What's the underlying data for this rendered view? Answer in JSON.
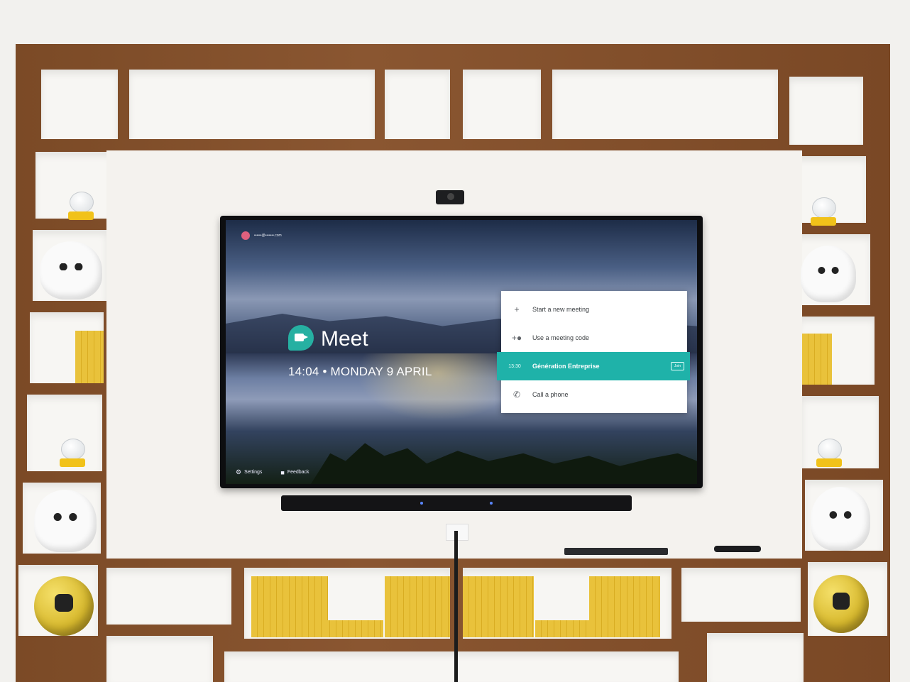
{
  "account": {
    "email": "••••••@•••••••.com"
  },
  "app": {
    "name": "Meet"
  },
  "clock": {
    "text": "14:04 • MONDAY 9 APRIL"
  },
  "menu": {
    "items": [
      {
        "icon": "plus-icon",
        "label": "Start a new meeting"
      },
      {
        "icon": "add-person-icon",
        "label": "Use a meeting code"
      },
      {
        "icon": "phone-icon",
        "label": "Call a phone"
      }
    ],
    "scheduled": {
      "time": "13:30",
      "title": "Génération Entreprise",
      "action": "Join"
    }
  },
  "footer": {
    "settings": "Settings",
    "feedback": "Feedback"
  },
  "colors": {
    "accent": "#1fb2a9",
    "meet_logo": "#26b0a2"
  }
}
